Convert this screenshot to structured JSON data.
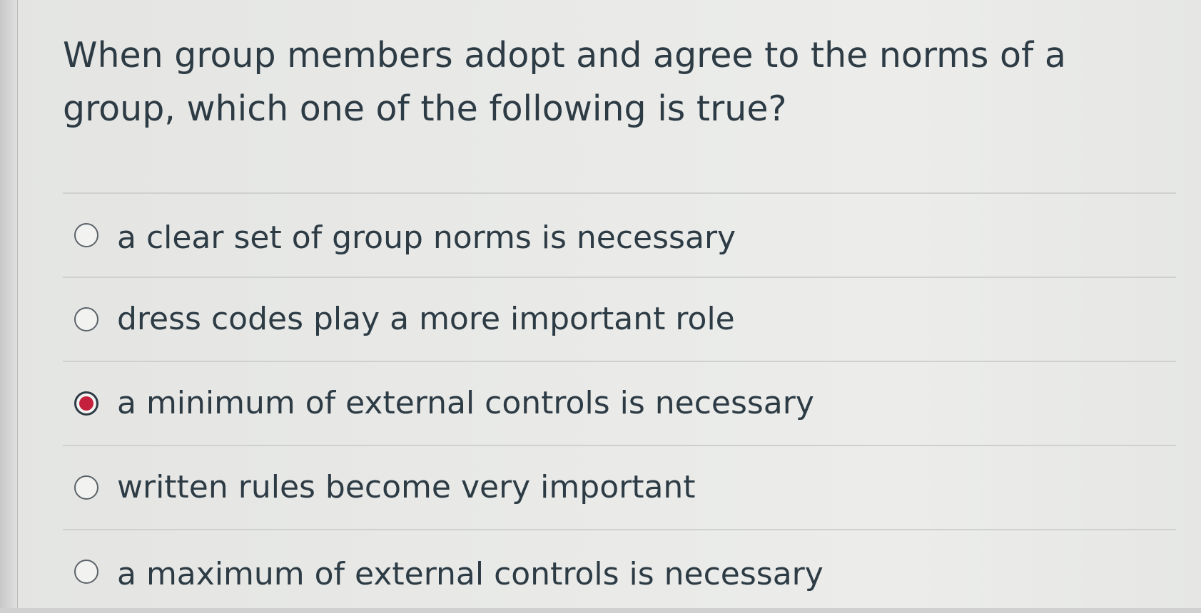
{
  "question": {
    "text": "When group members adopt and agree to the norms of a group, which one of the following is true?"
  },
  "answers": [
    {
      "label": "a clear set of group norms is necessary",
      "selected": false
    },
    {
      "label": "dress codes play a more important role",
      "selected": false
    },
    {
      "label": "a minimum of external controls is necessary",
      "selected": true
    },
    {
      "label": "written rules become very important",
      "selected": false
    },
    {
      "label": "a maximum of external controls is necessary",
      "selected": false
    }
  ],
  "colors": {
    "text": "#2d3b45",
    "selected_accent": "#c4203d",
    "divider": "#cfd1cf"
  }
}
